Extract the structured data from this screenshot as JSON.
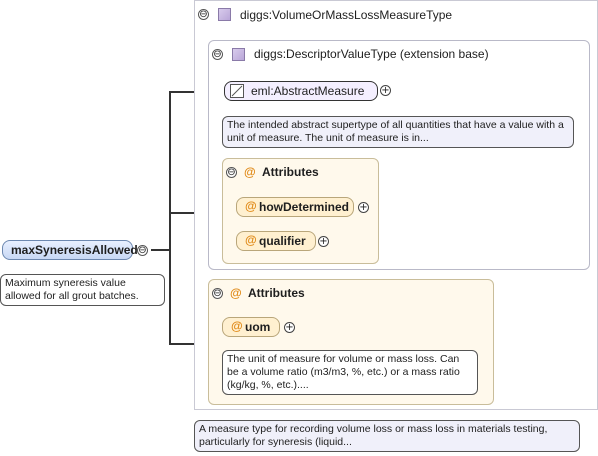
{
  "root": {
    "element": "maxSyneresisAllowed",
    "description": "Maximum syneresis value allowed for all grout batches."
  },
  "type": {
    "name": "diggs:VolumeOrMassLossMeasureType",
    "description": "A measure type for recording volume loss or mass loss in materials testing, particularly for syneresis (liquid..."
  },
  "base": {
    "name": "diggs:DescriptorValueType (extension base)",
    "element": "eml:AbstractMeasure",
    "element_description": "The intended abstract supertype of all quantities that have a value with a unit of measure. The unit of measure is in...",
    "attributes_label": "Attributes",
    "attributes": [
      "howDetermined",
      "qualifier"
    ]
  },
  "ext_attributes": {
    "label": "Attributes",
    "attribute": "uom",
    "description": "The unit of measure for volume or mass loss. Can be a volume ratio (m3/m3, %, etc.) or a mass ratio (kg/kg, %, etc.)...."
  },
  "symbols": {
    "collapse": "⊖",
    "expand": "+",
    "attr_marker": "@"
  }
}
